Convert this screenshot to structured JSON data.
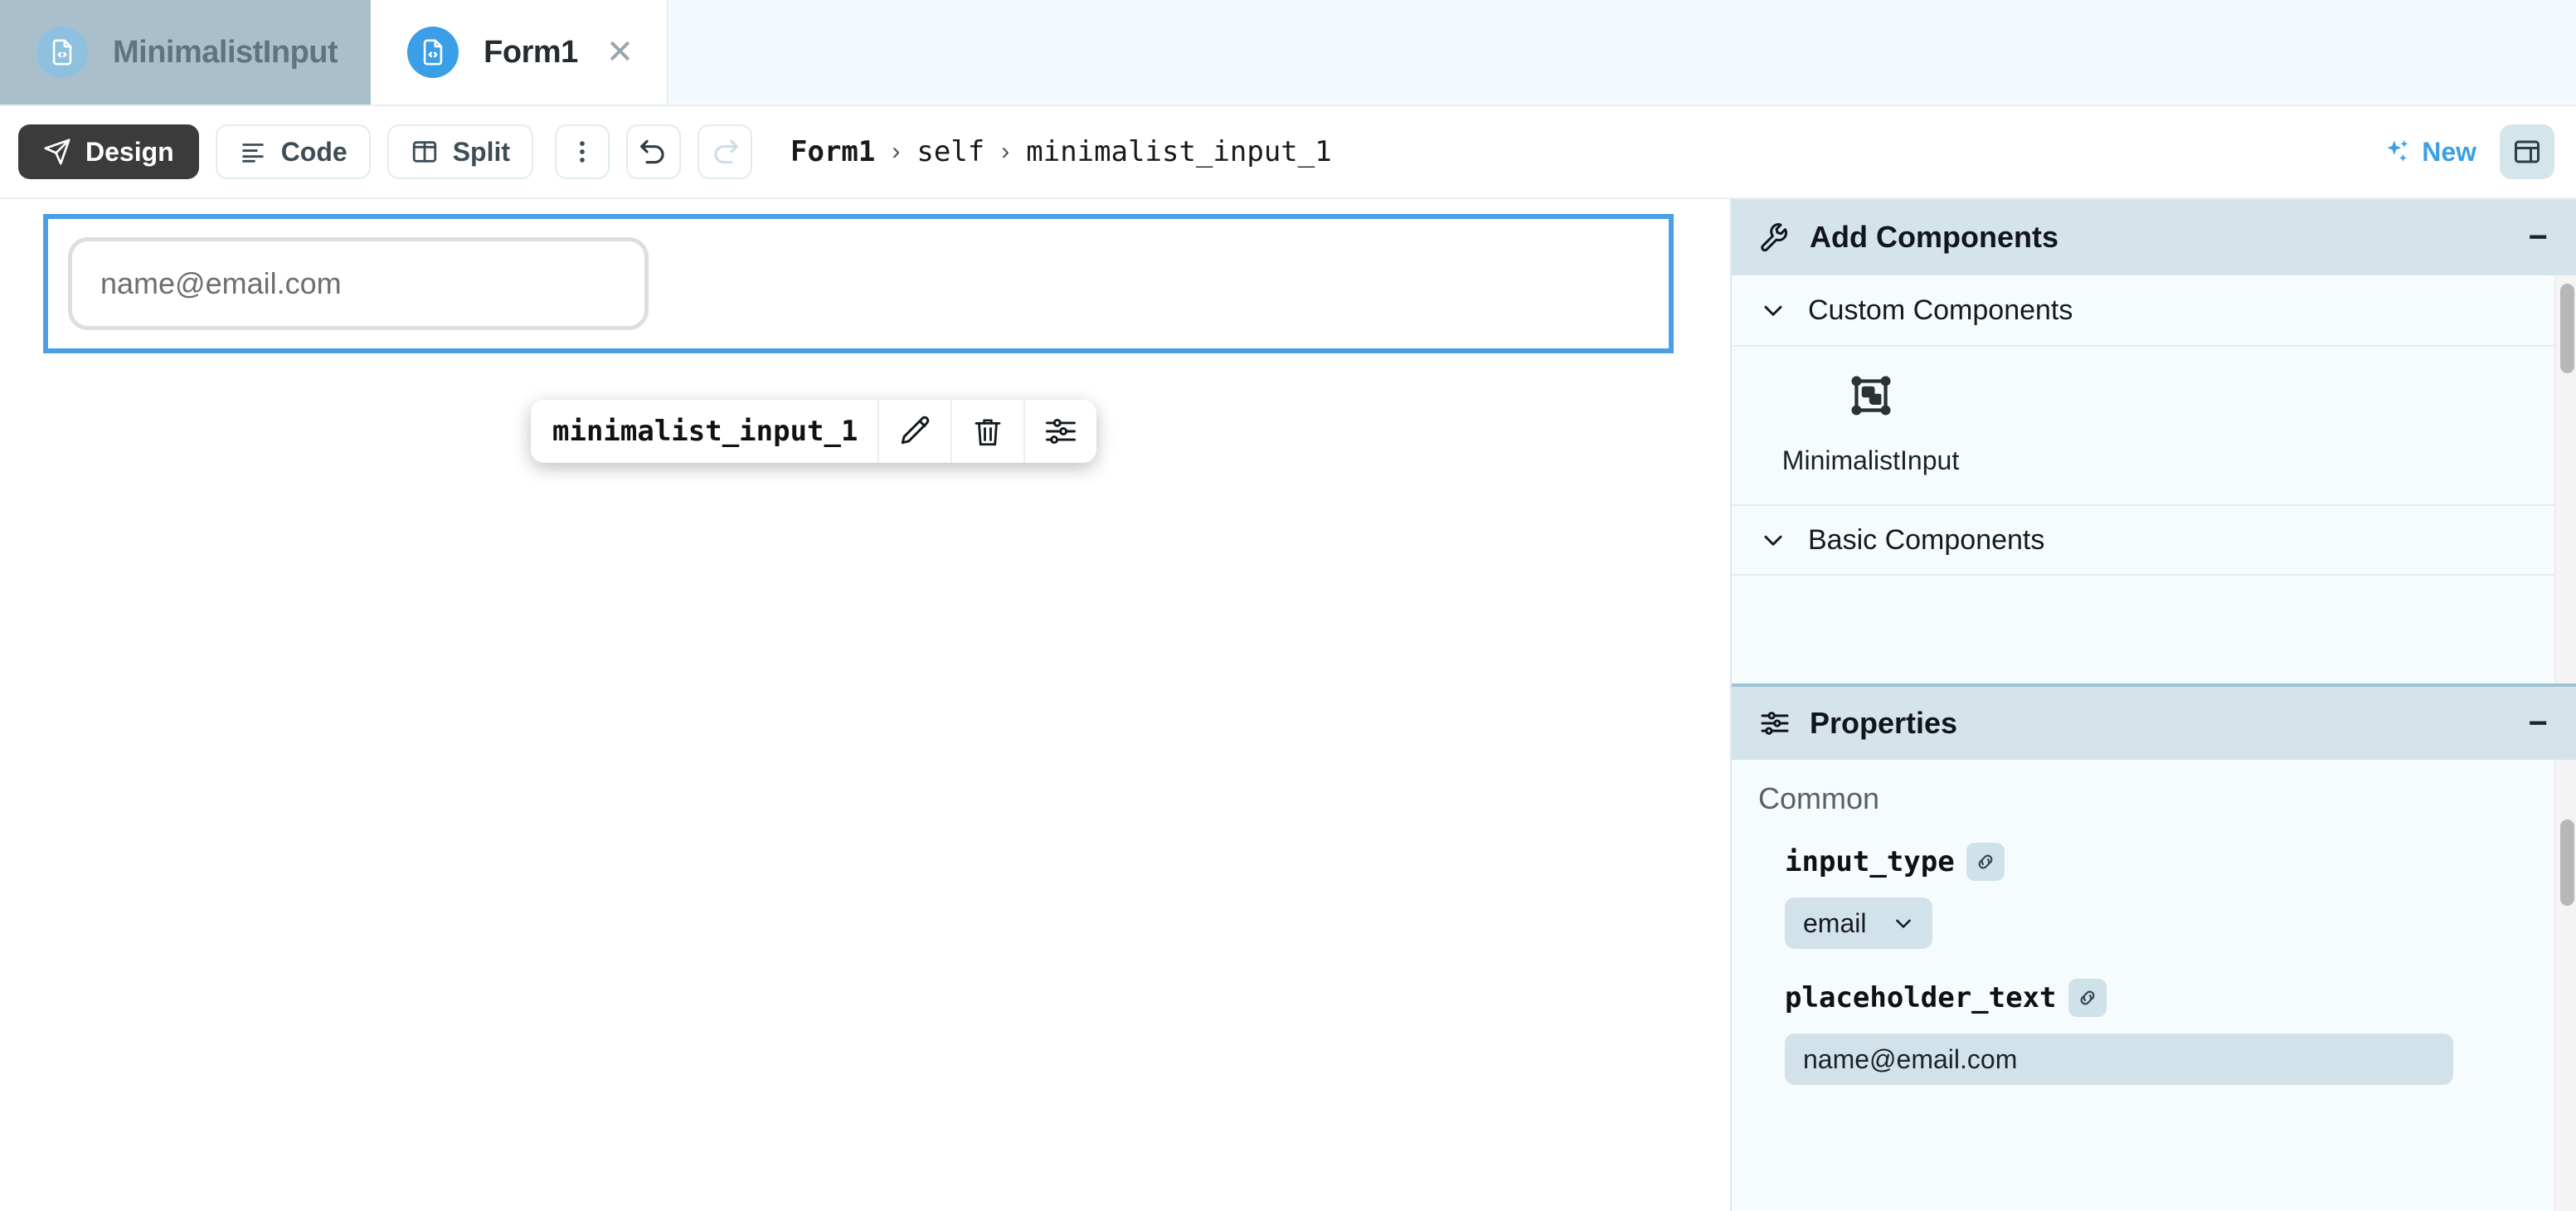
{
  "tabs": [
    {
      "label": "MinimalistInput",
      "icon": "file-code-icon",
      "active": false,
      "closable": false
    },
    {
      "label": "Form1",
      "icon": "file-code-icon",
      "active": true,
      "closable": true,
      "close_glyph": "✕"
    }
  ],
  "toolbar": {
    "design_label": "Design",
    "code_label": "Code",
    "split_label": "Split",
    "more_icon": "kebab-menu-icon",
    "undo_icon": "undo-icon",
    "redo_icon": "redo-icon",
    "new_label": "New",
    "new_icon": "sparkles-icon",
    "layout_icon": "panel-layout-icon"
  },
  "breadcrumb": {
    "root": "Form1",
    "separator": "›",
    "items": [
      "self",
      "minimalist_input_1"
    ]
  },
  "canvas": {
    "input_placeholder": "name@email.com",
    "floating_toolbar": {
      "component_name": "minimalist_input_1",
      "actions": [
        {
          "icon": "pencil-icon",
          "name": "edit-component-button"
        },
        {
          "icon": "trash-icon",
          "name": "delete-component-button"
        },
        {
          "icon": "sliders-icon",
          "name": "settings-component-button"
        }
      ]
    }
  },
  "panels": {
    "add_components": {
      "title": "Add Components",
      "icon": "wrench-icon",
      "collapse_glyph": "−",
      "groups": [
        {
          "label": "Custom Components",
          "chevron": "chevron-down-icon",
          "expanded": true
        },
        {
          "label": "Basic Components",
          "chevron": "chevron-down-icon",
          "expanded": false
        }
      ],
      "custom_components": [
        {
          "label": "MinimalistInput",
          "icon": "component-frame-icon"
        }
      ]
    },
    "properties": {
      "title": "Properties",
      "icon": "sliders-icon",
      "collapse_glyph": "−",
      "section_title": "Common",
      "fields": [
        {
          "name": "input_type",
          "type": "select",
          "value": "email",
          "link_icon": "link-chain-icon",
          "chevron": "chevron-down-icon"
        },
        {
          "name": "placeholder_text",
          "type": "text",
          "value": "name@email.com",
          "link_icon": "link-chain-icon"
        }
      ]
    }
  },
  "colors": {
    "accent_blue": "#3b9fe8",
    "selection_blue": "#4a9fe8",
    "panel_header": "#d5e4eb",
    "panel_bg": "#f6fbfd",
    "inactive_tab": "#a9c0cc",
    "dark_button": "#3b3b3b",
    "field_fill": "#d2e2ea"
  }
}
